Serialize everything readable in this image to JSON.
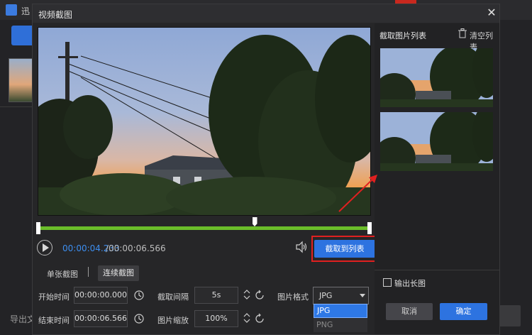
{
  "background_app": {
    "title": "迅",
    "export_label": "导出文"
  },
  "dialog": {
    "title": "视频截图",
    "close_icon": "close-icon"
  },
  "player": {
    "current_time": "00:00:04.233",
    "total_time": "/00:00:06.566",
    "capture_button": "截取到列表",
    "timeline_progress": 0.65
  },
  "tabs": {
    "single": "单张截图",
    "continuous": "连续截图"
  },
  "settings": {
    "start_label": "开始时间",
    "start_value": "00:00:00.000",
    "end_label": "结束时间",
    "end_value": "00:00:06.566",
    "interval_label": "截取间隔",
    "interval_value": "5s",
    "scale_label": "图片缩放",
    "scale_value": "100%",
    "format_label": "图片格式",
    "format_value": "JPG",
    "format_options": [
      "JPG",
      "PNG"
    ]
  },
  "right_panel": {
    "title": "截取图片列表",
    "clear_label": "清空列表",
    "long_image_label": "输出长图",
    "cancel": "取消",
    "ok": "确定"
  },
  "colors": {
    "accent": "#2d73e0",
    "timeline": "#6bbd2a",
    "highlight": "#e02020"
  }
}
